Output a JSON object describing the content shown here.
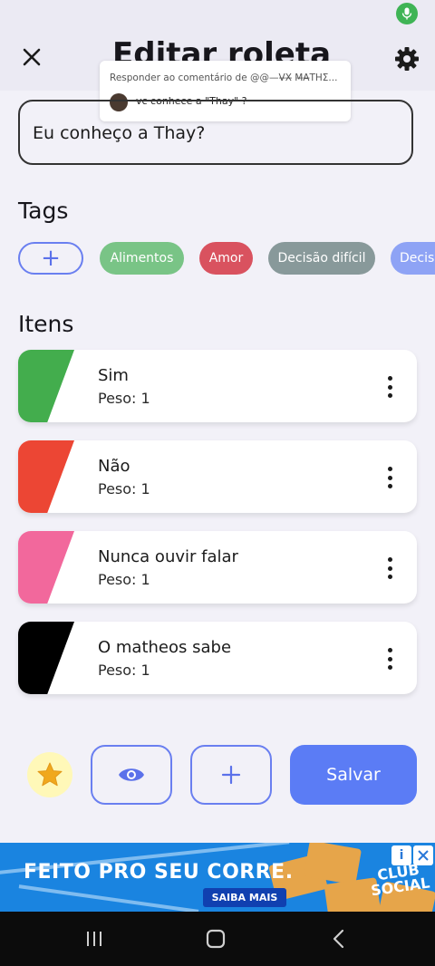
{
  "header": {
    "title": "Editar roleta"
  },
  "comment_popup": {
    "reply_line": "Responder ao comentário de @@—V̶X̶ M̶A̶THΣ...",
    "comment_text": "vc conhece a \"Thay\" ?"
  },
  "question": {
    "value": "Eu conheço a Thay?"
  },
  "tags": {
    "heading": "Tags",
    "items": [
      {
        "label": "Alimentos",
        "color": "#79c486"
      },
      {
        "label": "Amor",
        "color": "#d9525f"
      },
      {
        "label": "Decisão difícil",
        "color": "#88999a"
      },
      {
        "label": "Decis",
        "color": "#8ea3f5"
      }
    ]
  },
  "items_section": {
    "heading": "Itens",
    "weight_label": "Peso: 1",
    "items": [
      {
        "name": "Sim",
        "weight": "Peso: 1",
        "color": "#43ad4d"
      },
      {
        "name": "Não",
        "weight": "Peso: 1",
        "color": "#ec4634"
      },
      {
        "name": "Nunca ouvir falar",
        "weight": "Peso: 1",
        "color": "#f2689c"
      },
      {
        "name": "O matheos sabe",
        "weight": "Peso: 1",
        "color": "#000000"
      }
    ]
  },
  "actions": {
    "save_label": "Salvar"
  },
  "ad": {
    "headline": "FEITO PRO SEU CORRE.",
    "cta": "SAIBA MAIS",
    "brand_line1": "CLUB",
    "brand_line2": "SOCIAL"
  }
}
